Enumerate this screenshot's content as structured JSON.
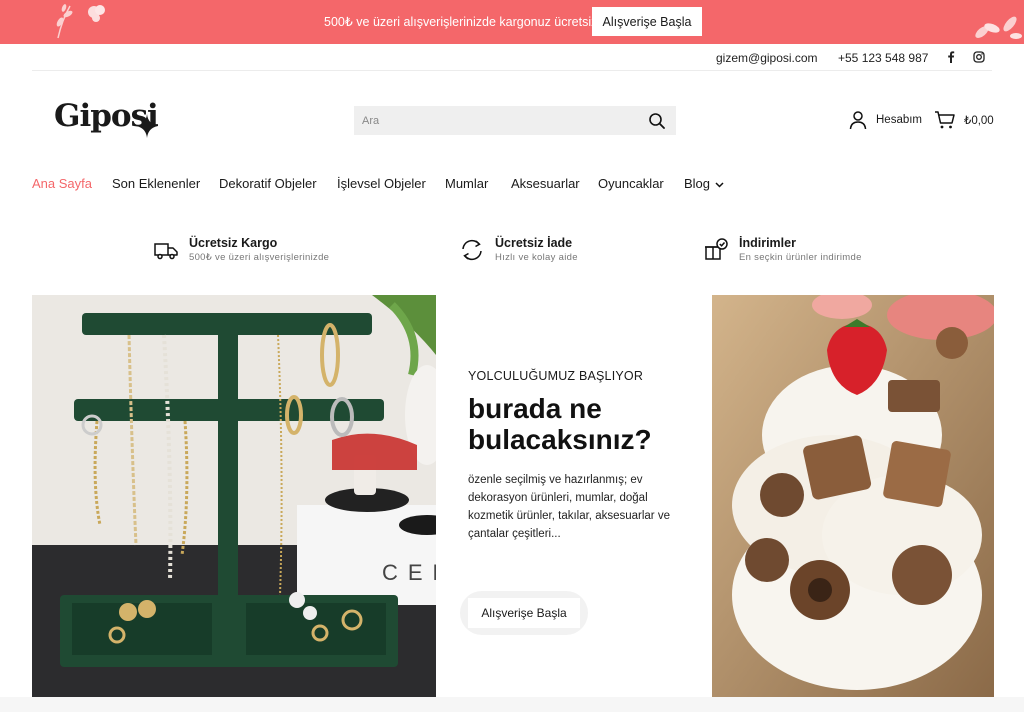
{
  "promo": {
    "text": "500₺ ve üzeri alışverişlerinizde kargonuz ücretsiz.",
    "button": "Alışverişe Başla",
    "background": "#f4676a"
  },
  "contact": {
    "email": "gizem@giposi.com",
    "phone": "+55 123 548 987",
    "social": [
      "facebook-icon",
      "instagram-icon"
    ]
  },
  "header": {
    "logo": "Giposi",
    "search_placeholder": "Ara",
    "account_label": "Hesabım",
    "cart_total": "₺0,00"
  },
  "nav": {
    "items": [
      {
        "label": "Ana Sayfa",
        "active": true
      },
      {
        "label": "Son Eklenenler"
      },
      {
        "label": "Dekoratif Objeler"
      },
      {
        "label": "İşlevsel Objeler"
      },
      {
        "label": "Mumlar"
      },
      {
        "label": "Aksesuarlar"
      },
      {
        "label": "Oyuncaklar"
      },
      {
        "label": "Blog",
        "has_dropdown": true
      }
    ],
    "accent": "#f4676a"
  },
  "features": [
    {
      "icon": "truck-icon",
      "title": "Ücretsiz Kargo",
      "subtitle": "500₺ ve üzeri alışverişlerinizde"
    },
    {
      "icon": "return-icon",
      "title": "Ücretsiz İade",
      "subtitle": "Hızlı ve kolay aide"
    },
    {
      "icon": "gift-box-icon",
      "title": "İndirimler",
      "subtitle": "En seçkin ürünler indirimde"
    }
  ],
  "hero": {
    "eyebrow": "YOLCULUĞUMUZ BAŞLIYOR",
    "headline": "burada ne bulacaksınız?",
    "description": "özenle seçilmiş ve hazırlanmış; ev dekorasyon ürünleri, mumlar, doğal kozmetik ürünler, takılar, aksesuarlar ve çantalar çeşitleri...",
    "cta": "Alışverişe Başla",
    "left_image": "jewelry-stand-image",
    "right_image": "dessert-candle-image"
  }
}
